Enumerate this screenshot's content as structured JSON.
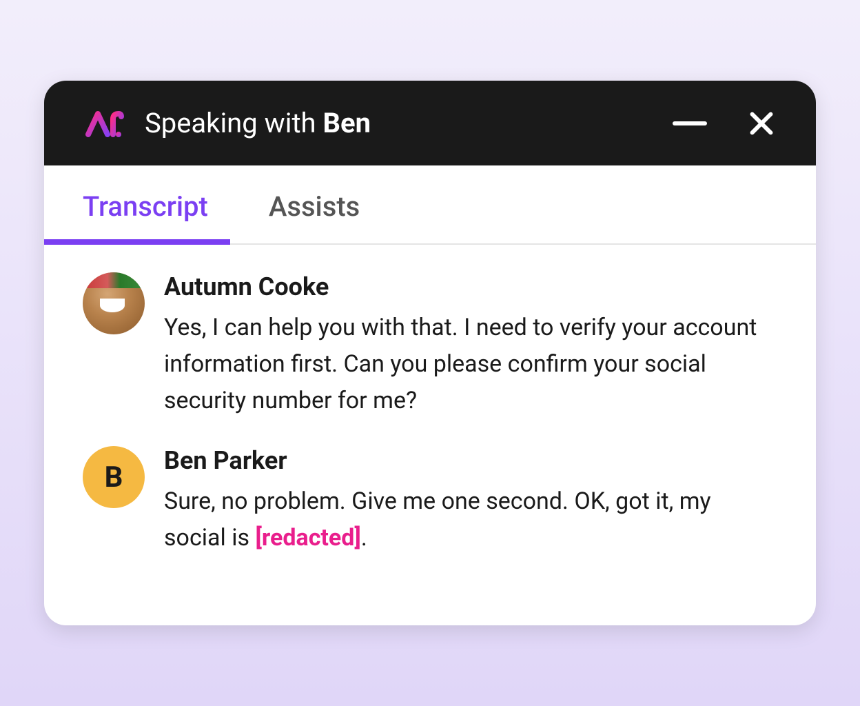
{
  "header": {
    "title_prefix": "Speaking with ",
    "title_name": "Ben"
  },
  "tabs": [
    {
      "label": "Transcript",
      "active": true
    },
    {
      "label": "Assists",
      "active": false
    }
  ],
  "transcript": {
    "messages": [
      {
        "author": "Autumn Cooke",
        "avatar_type": "photo",
        "avatar_letter": "",
        "text": "Yes, I can help you with that. I need to verify your account information first. Can you please confirm your social security number for me?",
        "redacted": null
      },
      {
        "author": "Ben Parker",
        "avatar_type": "letter",
        "avatar_letter": "B",
        "text_before": "Sure, no problem. Give me one second. OK, got it, my social is ",
        "redacted": "[redacted]",
        "text_after": "."
      }
    ]
  },
  "colors": {
    "accent": "#7b3ff2",
    "redacted": "#e91e8c",
    "avatar_bg": "#f5b942"
  }
}
